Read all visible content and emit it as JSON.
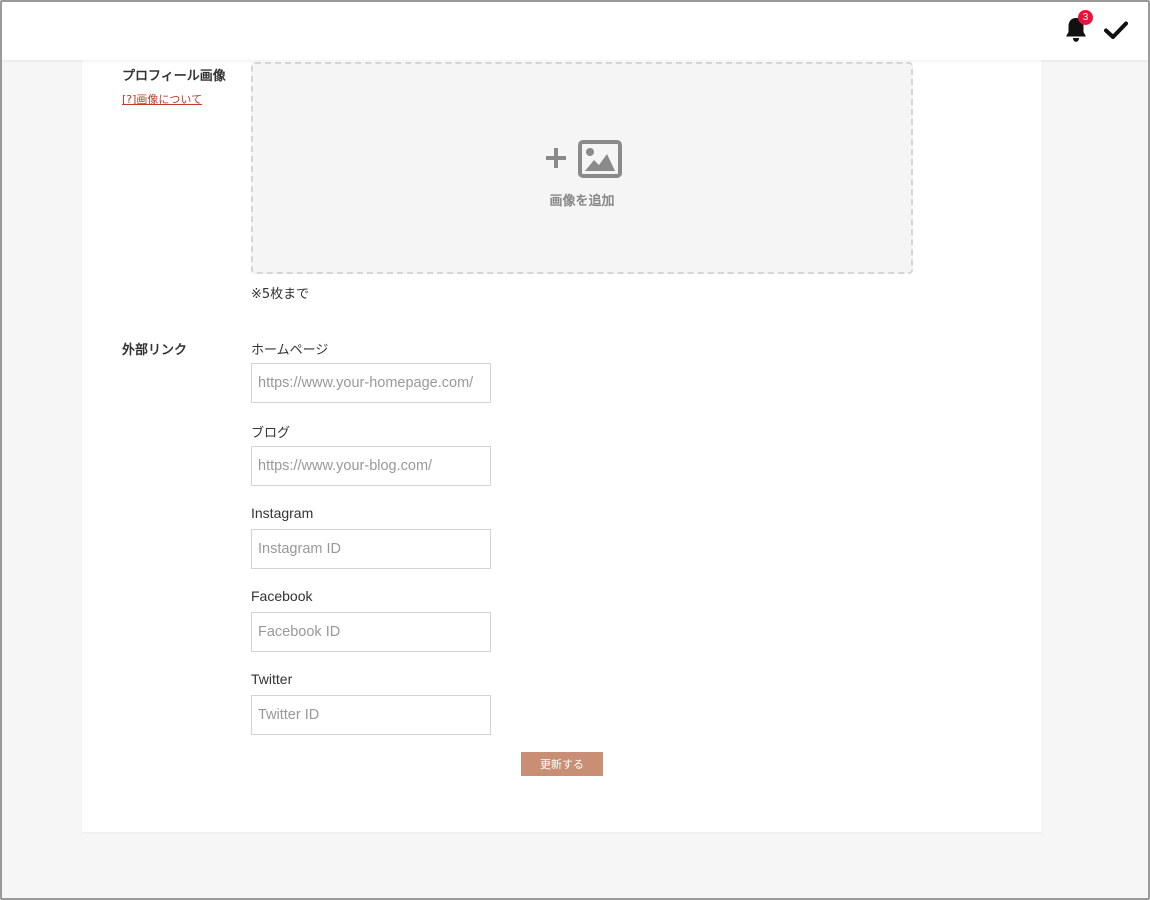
{
  "header": {
    "notification_count": "3",
    "bell_icon": "bell-icon",
    "check_icon": "checkmark-icon"
  },
  "profile_image": {
    "label": "プロフィール画像",
    "help_link": "[?]画像について",
    "add_label": "画像を追加",
    "limit_note": "※5枚まで",
    "icons": [
      "plus-icon",
      "image-icon"
    ]
  },
  "external_links": {
    "label": "外部リンク",
    "fields": {
      "homepage": {
        "label": "ホームページ",
        "placeholder": "https://www.your-homepage.com/"
      },
      "blog": {
        "label": "ブログ",
        "placeholder": "https://www.your-blog.com/"
      },
      "instagram": {
        "label": "Instagram",
        "placeholder": "Instagram ID"
      },
      "facebook": {
        "label": "Facebook",
        "placeholder": "Facebook ID"
      },
      "twitter": {
        "label": "Twitter",
        "placeholder": "Twitter ID"
      }
    }
  },
  "submit_label": "更新する",
  "colors": {
    "accent_button": "#c98f74",
    "badge": "#e8123c",
    "help_link": "#c0392b"
  }
}
